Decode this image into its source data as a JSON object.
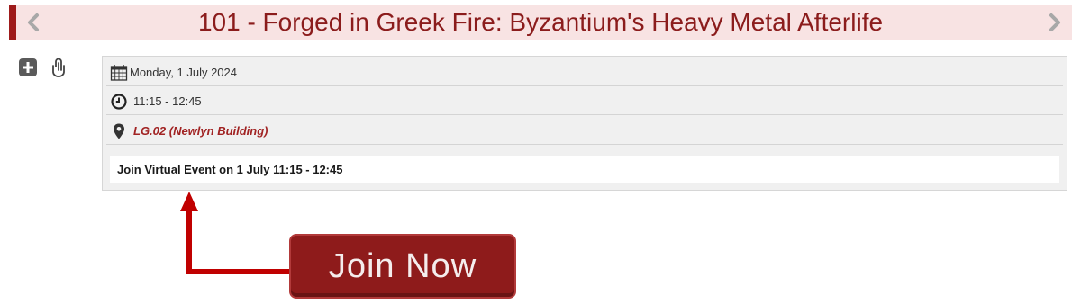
{
  "header": {
    "title": "101 - Forged in Greek Fire: Byzantium's Heavy Metal Afterlife",
    "prev_icon": "chevron-left-icon",
    "next_icon": "chevron-right-icon"
  },
  "toolbar": {
    "add_icon": "plus-square-icon",
    "attach_icon": "paperclip-icon"
  },
  "event": {
    "date": "Monday, 1 July 2024",
    "time": "11:15 - 12:45",
    "location": "LG.02 (Newlyn Building)",
    "virtual_link": "Join Virtual Event on 1 July 11:15 - 12:45"
  },
  "callout": {
    "button_label": "Join Now"
  },
  "colors": {
    "accent": "#9e1b1b",
    "title_bg": "#f8e3e3",
    "title_text": "#8b1c1c",
    "location_text": "#a12323",
    "button_bg": "#8e1b1b",
    "arrow": "#c00000"
  }
}
